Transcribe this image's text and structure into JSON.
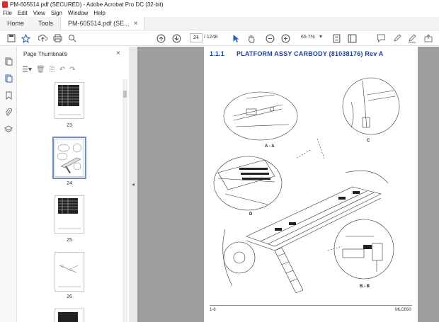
{
  "window": {
    "title": "PM-605514.pdf (SECURED) - Adobe Acrobat Pro DC (32-bit)"
  },
  "menu": [
    "File",
    "Edit",
    "View",
    "Sign",
    "Window",
    "Help"
  ],
  "tabs": {
    "home": "Home",
    "tools": "Tools",
    "document": "PM-605514.pdf (SE..."
  },
  "toolbar": {
    "current_page": "24",
    "total_pages": "/ 1248",
    "zoom": "66.7%"
  },
  "thumbnails": {
    "title": "Page Thumbnails",
    "pages": [
      {
        "label": "23"
      },
      {
        "label": "24",
        "selected": true
      },
      {
        "label": "25"
      },
      {
        "label": "26"
      }
    ]
  },
  "document": {
    "section": "1.1.1",
    "heading": "PLATFORM ASSY CARBODY (81038176) Rev A",
    "footer_left": "1-8",
    "footer_right": "MLC650",
    "view_labels": {
      "aa": "A - A",
      "c": "C",
      "d": "D",
      "bb": "B - B"
    }
  },
  "colors": {
    "heading": "#1f3fa0",
    "viewer_bg": "#9e9e9e",
    "selection": "#6d8fc8"
  }
}
